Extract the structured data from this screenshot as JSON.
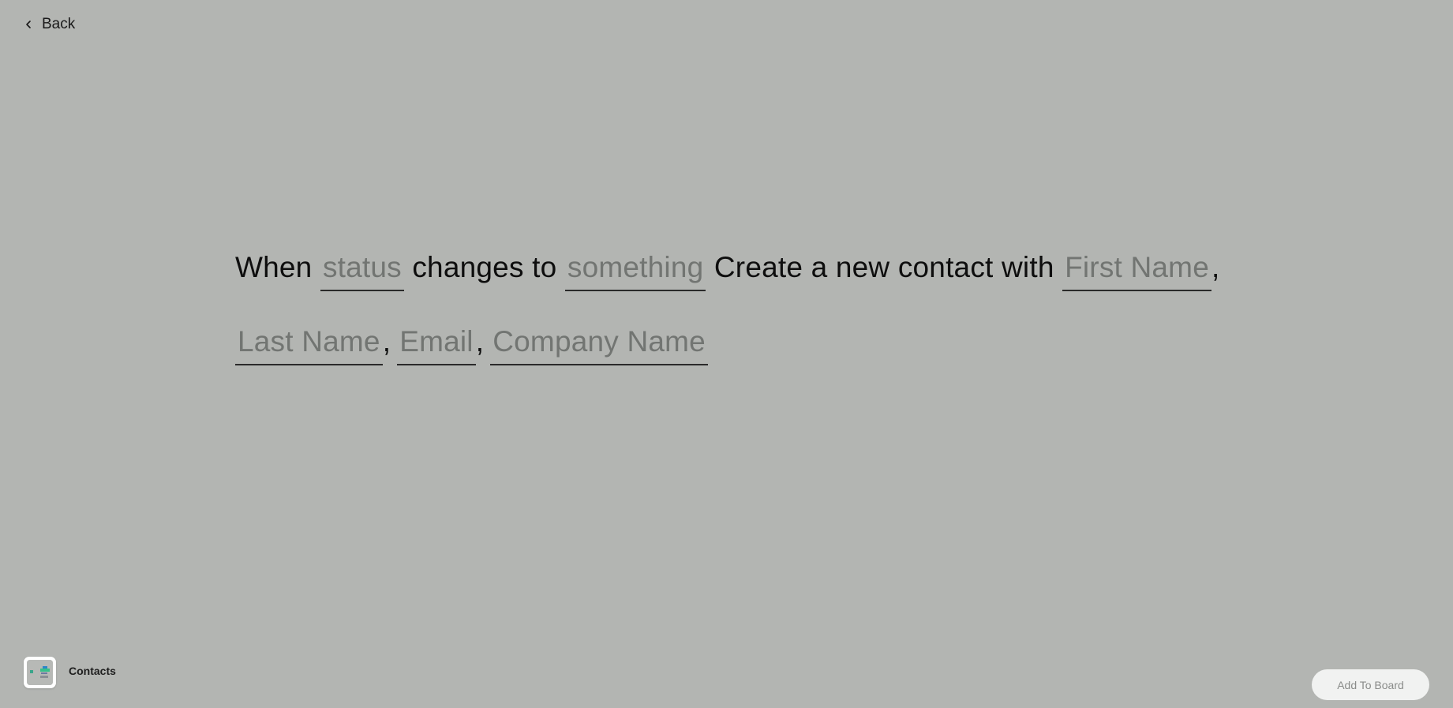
{
  "nav": {
    "back_label": "Back",
    "back_icon": "chevron-left-icon"
  },
  "sentence": {
    "when": "When",
    "trigger_column": "status",
    "changes_to": "changes to",
    "trigger_value": "something",
    "action_text": "Create a new contact with",
    "fields": [
      {
        "placeholder": "First Name"
      },
      {
        "placeholder": "Last Name"
      },
      {
        "placeholder": "Email"
      },
      {
        "placeholder": "Company Name"
      }
    ],
    "separator": ","
  },
  "integration": {
    "name": "Contacts",
    "icon": "contacts-app-icon"
  },
  "actions": {
    "add_label": "Add To Board"
  },
  "colors": {
    "background": "#b3b5b2",
    "placeholder_text": "#727572",
    "button_bg": "#f1f2f1",
    "button_text": "#8a8c8a"
  }
}
